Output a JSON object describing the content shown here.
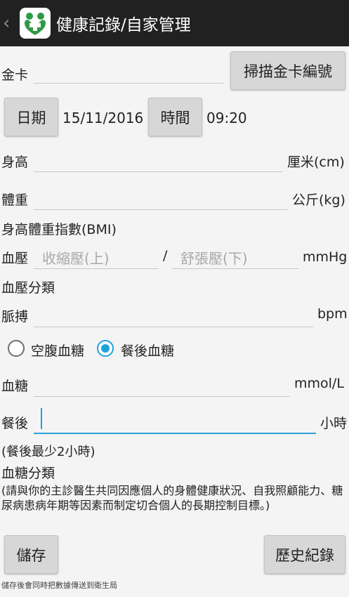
{
  "header": {
    "title": "健康記錄/自家管理"
  },
  "gold_card": {
    "label": "金卡",
    "scan_button": "掃描金卡編號"
  },
  "datetime": {
    "date_button": "日期",
    "date_value": "15/11/2016",
    "time_button": "時間",
    "time_value": "09:20"
  },
  "height": {
    "label": "身高",
    "unit": "厘米(cm)"
  },
  "weight": {
    "label": "體重",
    "unit": "公斤(kg)"
  },
  "bmi": {
    "label": "身高體重指數(BMI)"
  },
  "blood_pressure": {
    "label": "血壓",
    "systolic_placeholder": "收縮壓(上)",
    "separator": "/",
    "diastolic_placeholder": "舒張壓(下)",
    "unit": "mmHg"
  },
  "bp_category": {
    "label": "血壓分類"
  },
  "pulse": {
    "label": "脈搏",
    "unit": "bpm"
  },
  "glucose_type": {
    "fasting": "空腹血糖",
    "postprandial": "餐後血糖",
    "selected": "postprandial"
  },
  "glucose": {
    "label": "血糖",
    "unit": "mmol/L"
  },
  "after_meal": {
    "label": "餐後",
    "unit": "小時",
    "hint": "(餐後最少2小時)"
  },
  "glucose_category": {
    "label": "血糖分類"
  },
  "advice": "(請與你的主診醫生共同因應個人的身體健康狀況、自我照顧能力、糖尿病患病年期等因素而制定切合個人的長期控制目標。)",
  "actions": {
    "save": "儲存",
    "history": "歷史紀錄"
  },
  "footer": "儲存後會同時把數據傳送到衛生局",
  "colors": {
    "accent": "#1ea3dc",
    "header_bg": "#212121",
    "logo_green": "#2e9a48"
  }
}
